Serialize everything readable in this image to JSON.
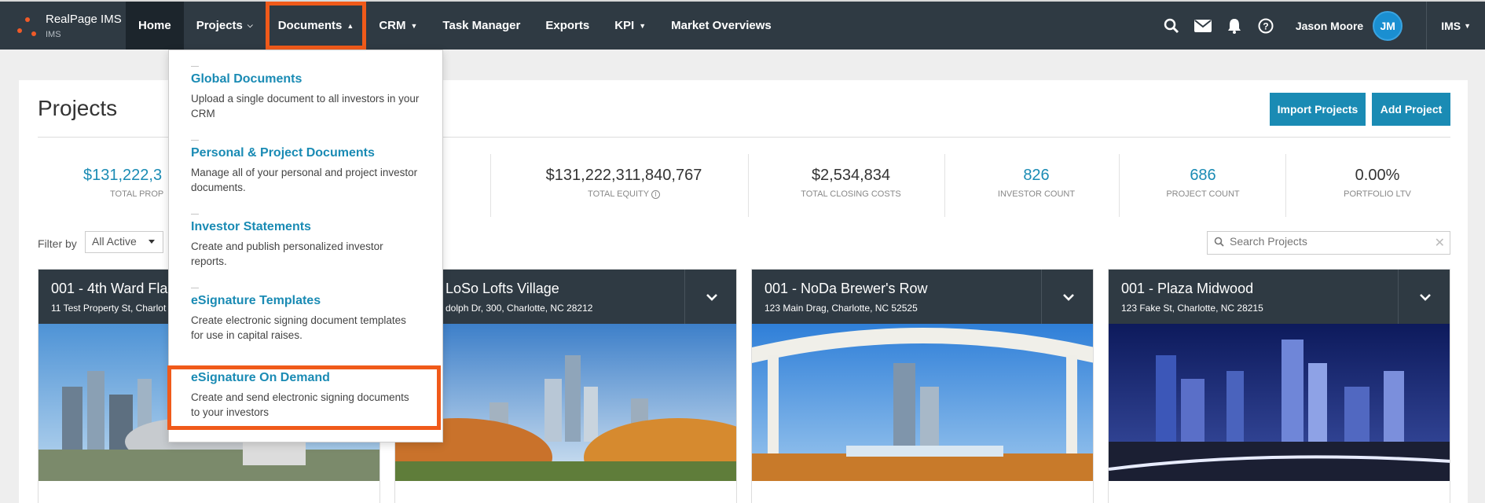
{
  "brand": {
    "name": "RealPage IMS",
    "sub": "IMS"
  },
  "nav": {
    "items": [
      {
        "label": "Home",
        "chevron": ""
      },
      {
        "label": "Projects",
        "chevron": "⌄"
      },
      {
        "label": "Documents",
        "chevron": "^"
      },
      {
        "label": "CRM",
        "chevron": "⌄"
      },
      {
        "label": "Task Manager",
        "chevron": ""
      },
      {
        "label": "Exports",
        "chevron": ""
      },
      {
        "label": "KPI",
        "chevron": "⌄"
      },
      {
        "label": "Market Overviews",
        "chevron": ""
      }
    ],
    "user_name": "Jason Moore",
    "avatar_initials": "JM",
    "org": "IMS",
    "icons": [
      "search-icon",
      "mail-icon",
      "bell-icon",
      "help-icon"
    ]
  },
  "page": {
    "title": "Projects",
    "import_label": "Import Projects",
    "add_label": "Add Project"
  },
  "stats": [
    {
      "value": "$131,222,3",
      "label": "TOTAL PROP"
    },
    {
      "value": "$131,222,311,840,767",
      "label": "TOTAL EQUITY"
    },
    {
      "value": "$2,534,834",
      "label": "TOTAL CLOSING COSTS"
    },
    {
      "value": "826",
      "label": "INVESTOR COUNT"
    },
    {
      "value": "686",
      "label": "PROJECT COUNT"
    },
    {
      "value": "0.00%",
      "label": "PORTFOLIO LTV"
    }
  ],
  "filter": {
    "label": "Filter by",
    "value": "All Active"
  },
  "search": {
    "placeholder": "Search Projects"
  },
  "cards": [
    {
      "title": "001 - 4th Ward Fla",
      "address": "11 Test Property St, Charlot"
    },
    {
      "title": "LoSo Lofts Village",
      "address": "dolph Dr, 300, Charlotte, NC 28212"
    },
    {
      "title": "001 - NoDa Brewer's Row",
      "address": "123 Main Drag, Charlotte, NC 52525"
    },
    {
      "title": "001 - Plaza Midwood",
      "address": "123 Fake St, Charlotte, NC 28215"
    }
  ],
  "documents_menu": [
    {
      "title": "Global Documents",
      "desc": "Upload a single document to all investors in your CRM"
    },
    {
      "title": "Personal & Project Documents",
      "desc": "Manage all of your personal and project investor documents."
    },
    {
      "title": "Investor Statements",
      "desc": "Create and publish personalized investor reports."
    },
    {
      "title": "eSignature Templates",
      "desc": "Create electronic signing document templates for use in capital raises."
    },
    {
      "title": "eSignature On Demand",
      "desc": "Create and send electronic signing documents to your investors"
    }
  ],
  "colors": {
    "nav_bg": "#2f3a43",
    "accent": "#1a8bb4",
    "highlight": "#f05a1a"
  }
}
